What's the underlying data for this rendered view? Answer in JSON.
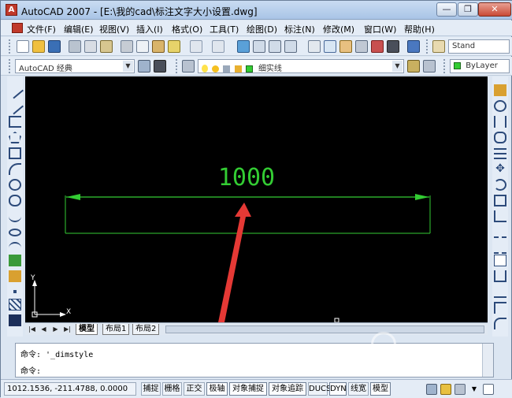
{
  "window": {
    "title": "AutoCAD 2007 - [E:\\我的cad\\标注文字大小设置.dwg]",
    "min_label": "—",
    "max_label": "❐",
    "close_label": "✕"
  },
  "menu": [
    "文件(F)",
    "编辑(E)",
    "视图(V)",
    "插入(I)",
    "格式(O)",
    "工具(T)",
    "绘图(D)",
    "标注(N)",
    "修改(M)",
    "窗口(W)",
    "帮助(H)"
  ],
  "toolbar1": {
    "text_style_combo": "Stand"
  },
  "toolbar2": {
    "workspace": "AutoCAD 经典",
    "layer": "细实线",
    "color": "ByLayer"
  },
  "drawing": {
    "dimension_text": "1000",
    "dimension_color": "#33cc33",
    "arrow_color": "#e53935"
  },
  "layout_tabs": [
    "模型",
    "布局1",
    "布局2"
  ],
  "command": {
    "history_line": "命令: '_dimstyle",
    "prompt": "命令:"
  },
  "status": {
    "coordinates": "1012.1536, -211.4788, 0.0000",
    "toggles": [
      "捕捉",
      "栅格",
      "正交",
      "极轴",
      "对象捕捉",
      "对象追踪",
      "DUCS",
      "DYN",
      "线宽",
      "模型"
    ]
  },
  "icons": {
    "ucs": "ucs-axis-icon",
    "nav": [
      "first-icon",
      "prev-icon",
      "next-icon",
      "last-icon"
    ]
  },
  "ucs": {
    "x_label": "X",
    "y_label": "Y"
  },
  "watermark": {
    "site": "zhinan.sogou.com"
  }
}
